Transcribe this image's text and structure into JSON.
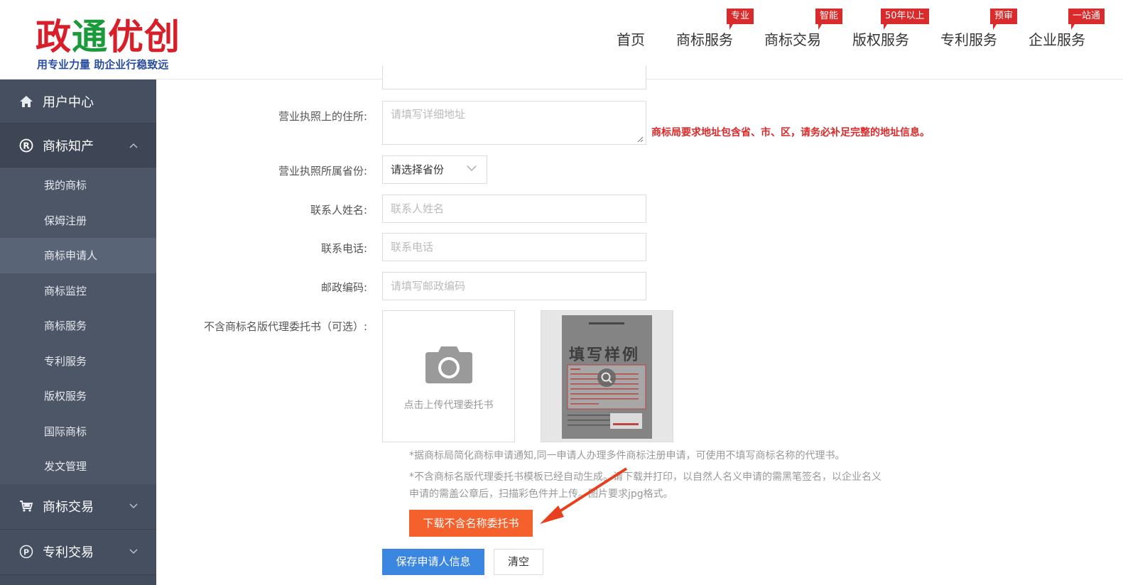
{
  "logo": {
    "title_part1": "政",
    "title_part2": "通",
    "title_part3": "优创",
    "slogan": "用专业力量 助企业行稳致远"
  },
  "nav": {
    "items": [
      {
        "label": "首页",
        "badge": ""
      },
      {
        "label": "商标服务",
        "badge": "专业"
      },
      {
        "label": "商标交易",
        "badge": "智能"
      },
      {
        "label": "版权服务",
        "badge": "50年以上"
      },
      {
        "label": "专利服务",
        "badge": "预审"
      },
      {
        "label": "企业服务",
        "badge": "一站通"
      }
    ]
  },
  "sidebar": {
    "user_center": "用户中心",
    "trademark_ip": "商标知产",
    "sub_items": [
      "我的商标",
      "保姆注册",
      "商标申请人",
      "商标监控",
      "商标服务",
      "专利服务",
      "版权服务",
      "国际商标",
      "发文管理"
    ],
    "active_sub": "商标申请人",
    "trademark_trade": "商标交易",
    "patent_trade": "专利交易"
  },
  "form": {
    "address_label": "营业执照上的住所:",
    "address_placeholder": "请填写详细地址",
    "address_note": "商标局要求地址包含省、市、区，请务必补足完整的地址信息。",
    "province_label": "营业执照所属省份:",
    "province_value": "请选择省份",
    "contact_label": "联系人姓名:",
    "contact_placeholder": "联系人姓名",
    "phone_label": "联系电话:",
    "phone_placeholder": "联系电话",
    "zip_label": "邮政编码:",
    "zip_placeholder": "请填写邮政编码",
    "poa_label": "不含商标名版代理委托书（可选）:",
    "upload_text": "点击上传代理委托书",
    "sample_title": "填写样例",
    "tip1": "*据商标局简化商标申请通知,同一申请人办理多件商标注册申请，可使用不填写商标名称的代理书。",
    "tip2_line1": "*不含商标名版代理委托书模板已经自动生成。请下载并打印，以自然人名义申请的需黑笔签名，以企业名义",
    "tip2_line2": "申请的需盖公章后，扫描彩色件并上传。图片要求jpg格式。",
    "download_button": "下载不含名称委托书",
    "save_button": "保存申请人信息",
    "clear_button": "清空"
  },
  "colors": {
    "brand_red": "#d92b2b",
    "sidebar_bg": "#434c5c",
    "primary_blue": "#3a86e0",
    "download_orange": "#f4612c"
  }
}
